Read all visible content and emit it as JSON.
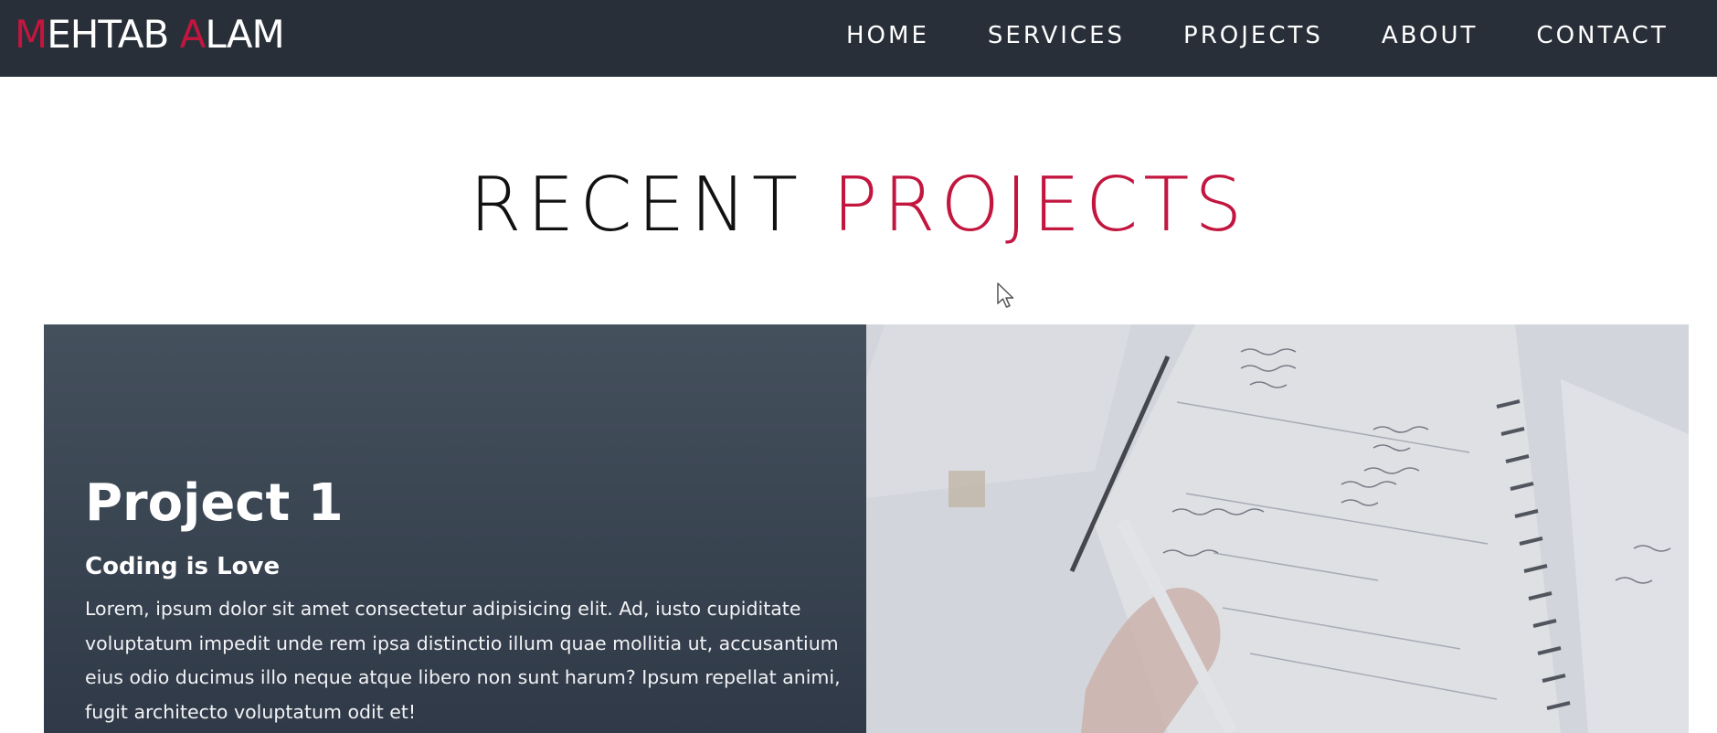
{
  "brand": {
    "initial_1": "M",
    "rest_1": "EHTAB ",
    "initial_2": "A",
    "rest_2": "LAM"
  },
  "nav": {
    "items": [
      {
        "label": "HOME"
      },
      {
        "label": "SERVICES"
      },
      {
        "label": "PROJECTS"
      },
      {
        "label": "ABOUT"
      },
      {
        "label": "CONTACT"
      }
    ]
  },
  "section": {
    "title_part_1": "RECENT ",
    "title_part_2": "PROJECTS"
  },
  "project": {
    "title": "Project 1",
    "subtitle": "Coding is Love",
    "description": "Lorem, ipsum dolor sit amet consectetur adipisicing elit. Ad, iusto cupiditate voluptatum impedit unde rem ipsa distinctio illum quae mollitia ut, accusantium eius odio ducimus illo neque atque libero non sunt harum? Ipsum repellat animi, fugit architecto voluptatum odit et!",
    "image_icon": "planner-notebook-photo"
  },
  "colors": {
    "navbar": "#282f39",
    "accent": "#c2163f",
    "card_dark": "#3b4653"
  }
}
